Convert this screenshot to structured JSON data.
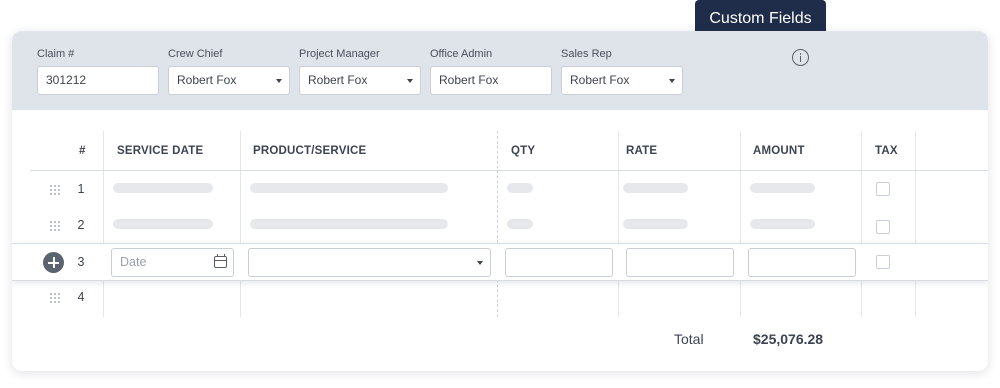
{
  "tooltip": {
    "text": "Custom Fields"
  },
  "header": {
    "claim": {
      "label": "Claim #",
      "value": "301212"
    },
    "crew_chief": {
      "label": "Crew Chief",
      "value": "Robert Fox"
    },
    "project_manager": {
      "label": "Project Manager",
      "value": "Robert Fox"
    },
    "office_admin": {
      "label": "Office Admin",
      "value": "Robert Fox"
    },
    "sales_rep": {
      "label": "Sales Rep",
      "value": "Robert Fox"
    }
  },
  "table": {
    "columns": [
      "#",
      "SERVICE DATE",
      "PRODUCT/SERVICE",
      "QTY",
      "RATE",
      "AMOUNT",
      "TAX"
    ],
    "rows": [
      "1",
      "2",
      "3",
      "4"
    ],
    "active_row": {
      "date_placeholder": "Date",
      "product_value": "",
      "qty_value": "",
      "rate_value": "",
      "amount_value": ""
    }
  },
  "footer": {
    "total_label": "Total",
    "total_value": "$25,076.28"
  },
  "colors": {
    "tooltip_bg": "#1f2d4a",
    "header_band": "#dfe3ea",
    "add_button": "#5b6270"
  },
  "icons": [
    "info-icon",
    "drag-handle-icon",
    "plus-icon",
    "calendar-icon",
    "chevron-down-icon"
  ]
}
